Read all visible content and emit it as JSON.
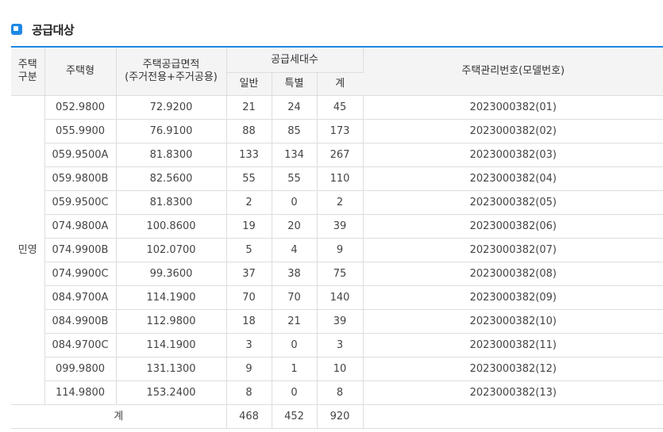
{
  "section": {
    "title": "공급대상",
    "accent_color": "#1e88e5",
    "icon": "square-bullet-icon"
  },
  "table": {
    "headers": {
      "housing_category": "주택\n구분",
      "housing_type": "주택형",
      "supply_area": "주택공급면적",
      "supply_area_sub": "(주거전용+주거공용)",
      "supply_units": "공급세대수",
      "general": "일반",
      "special": "특별",
      "total": "계",
      "mgmt_no": "주택관리번호(모델번호)"
    },
    "category_value": "민영",
    "rows": [
      {
        "type": "052.9800",
        "area": "72.9200",
        "general": "21",
        "special": "24",
        "total": "45",
        "mgmt_no": "2023000382(01)"
      },
      {
        "type": "055.9900",
        "area": "76.9100",
        "general": "88",
        "special": "85",
        "total": "173",
        "mgmt_no": "2023000382(02)"
      },
      {
        "type": "059.9500A",
        "area": "81.8300",
        "general": "133",
        "special": "134",
        "total": "267",
        "mgmt_no": "2023000382(03)"
      },
      {
        "type": "059.9800B",
        "area": "82.5600",
        "general": "55",
        "special": "55",
        "total": "110",
        "mgmt_no": "2023000382(04)"
      },
      {
        "type": "059.9500C",
        "area": "81.8300",
        "general": "2",
        "special": "0",
        "total": "2",
        "mgmt_no": "2023000382(05)"
      },
      {
        "type": "074.9800A",
        "area": "100.8600",
        "general": "19",
        "special": "20",
        "total": "39",
        "mgmt_no": "2023000382(06)"
      },
      {
        "type": "074.9900B",
        "area": "102.0700",
        "general": "5",
        "special": "4",
        "total": "9",
        "mgmt_no": "2023000382(07)"
      },
      {
        "type": "074.9900C",
        "area": "99.3600",
        "general": "37",
        "special": "38",
        "total": "75",
        "mgmt_no": "2023000382(08)"
      },
      {
        "type": "084.9700A",
        "area": "114.1900",
        "general": "70",
        "special": "70",
        "total": "140",
        "mgmt_no": "2023000382(09)"
      },
      {
        "type": "084.9900B",
        "area": "112.9800",
        "general": "18",
        "special": "21",
        "total": "39",
        "mgmt_no": "2023000382(10)"
      },
      {
        "type": "084.9700C",
        "area": "114.1900",
        "general": "3",
        "special": "0",
        "total": "3",
        "mgmt_no": "2023000382(11)"
      },
      {
        "type": "099.9800",
        "area": "131.1300",
        "general": "9",
        "special": "1",
        "total": "10",
        "mgmt_no": "2023000382(12)"
      },
      {
        "type": "114.9800",
        "area": "153.2400",
        "general": "8",
        "special": "0",
        "total": "8",
        "mgmt_no": "2023000382(13)"
      }
    ],
    "footer": {
      "label": "계",
      "general": "468",
      "special": "452",
      "total": "920",
      "mgmt_no": ""
    }
  }
}
